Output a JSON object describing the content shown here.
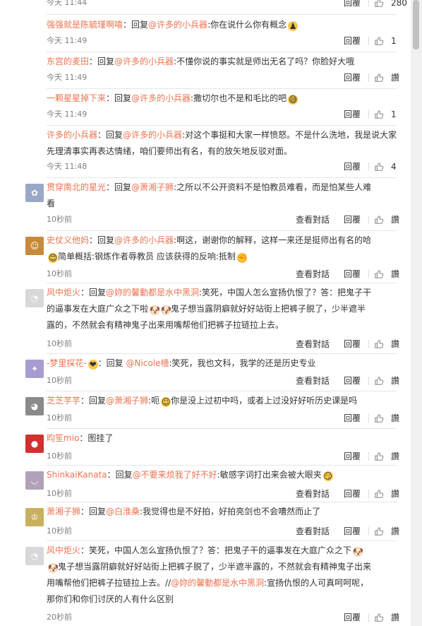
{
  "colors": {
    "link": "#eb7350",
    "text": "#333333",
    "meta": "#808080",
    "divider": "#e6e6e6"
  },
  "icons": {
    "like": "thumb-up-icon"
  },
  "actions": {
    "conversation": "查看對話",
    "reply": "回覆"
  },
  "top": {
    "time": "今天 11:44",
    "reply": "回覆",
    "likes": "280"
  },
  "comments": [
    {
      "user": "强强就是陈毓瑾啊嘻",
      "has_avatar": false,
      "segments": [
        {
          "t": "："
        },
        {
          "t": "回复"
        },
        {
          "t": "@许多的小兵器",
          "m": true
        },
        {
          "t": ":你在说什么你有概念"
        },
        {
          "e": "icon-emoji",
          "g": "♟"
        }
      ],
      "time": "今天 11:49",
      "conv": false,
      "likes": "1"
    },
    {
      "user": "东宫的麦田",
      "has_avatar": false,
      "segments": [
        {
          "t": "：回复"
        },
        {
          "t": "@许多的小兵器",
          "m": true
        },
        {
          "t": ":不懂你说的事实就是师出无名了吗？你脸好大哦"
        }
      ],
      "time": "今天 11:49",
      "conv": false,
      "likes": "讚"
    },
    {
      "user": "一颗星星掉下来",
      "has_avatar": false,
      "segments": [
        {
          "t": "：回复"
        },
        {
          "t": "@许多的小兵器",
          "m": true
        },
        {
          "t": ":撒切尔也不是和毛比的吧"
        },
        {
          "e": "sweat-face-emoji",
          "g": "😅"
        }
      ],
      "time": "今天 11:49",
      "conv": false,
      "likes": "1"
    },
    {
      "user": "许多的小兵器",
      "has_avatar": false,
      "segments": [
        {
          "t": "：回复"
        },
        {
          "t": "@许多的小兵器",
          "m": true
        },
        {
          "t": ":对这个事挺和大家一样愤怒。不是什么洗地，我是说大家"
        }
      ],
      "cont": [
        "先理清事实再表达情绪，咱们要师出有名，有的放矢地反驳对面。"
      ],
      "time": "今天 11:48",
      "conv": false,
      "likes": "4"
    },
    {
      "user": "贯穿南北的星光",
      "has_avatar": true,
      "avatar_color": "#9aa8c8",
      "avatar_glyph": "✿",
      "segments": [
        {
          "t": "：回复"
        },
        {
          "t": "@萧湘子狮",
          "m": true
        },
        {
          "t": ":之所以不公开资料不是怕教员难看，而是怕某些人难"
        }
      ],
      "cont": [
        "看"
      ],
      "time": "10秒前",
      "conv": true,
      "likes": "讚"
    },
    {
      "user": "史仗义他妈",
      "has_avatar": true,
      "avatar_color": "#c88a3a",
      "avatar_glyph": "☺",
      "segments": [
        {
          "t": "：回复"
        },
        {
          "t": "@许多的小兵器",
          "m": true
        },
        {
          "t": ":啊这，谢谢你的解释，这样一来还是挺师出有名的哈"
        }
      ],
      "cont_segments": [
        {
          "e": "smile-emoji",
          "g": "😊"
        },
        {
          "t": "简单概括:钢炼作者辱教员 应该获得的反响:抵制"
        },
        {
          "e": "fist-emoji",
          "g": "✊"
        }
      ],
      "time": "10秒前",
      "conv": true,
      "likes": "讚"
    },
    {
      "user": "风中炬火",
      "has_avatar": true,
      "avatar_color": "#d8d8d8",
      "avatar_glyph": "◔",
      "segments": [
        {
          "t": "：回复"
        },
        {
          "t": "@妳的馨動都是水中黑洞",
          "m": true
        },
        {
          "t": ":笑死，中国人怎么宣扬仇恨了？答：把鬼子干"
        }
      ],
      "cont_segments": [
        {
          "t": "的逼事发在大庭广众之下啦"
        },
        {
          "e": "dog-emoji",
          "g": "🐶"
        },
        {
          "e": "dog-emoji",
          "g": "🐶"
        },
        {
          "t": "鬼子想当露阴癖就好好站街上把裤子脱了，少半遮半"
        }
      ],
      "cont": [
        "露的，不然就会有精神鬼子出来用嘴帮他们把裤子拉链拉上去。"
      ],
      "time": "10秒前",
      "conv": true,
      "likes": "讚"
    },
    {
      "user": "-梦里探花-",
      "has_avatar": true,
      "avatar_color": "#a89bd0",
      "avatar_glyph": "✦",
      "segments": [
        {
          "e": "crown-emoji",
          "g": "❤"
        },
        {
          "t": "：回复 "
        },
        {
          "t": "@Nicole檣",
          "m": true
        },
        {
          "t": ":笑死，我也文科，我学的还是历史专业"
        }
      ],
      "time": "10秒前",
      "conv": true,
      "likes": "讚"
    },
    {
      "user": "芝芝芋芋",
      "has_avatar": true,
      "avatar_color": "#8a8a8a",
      "avatar_glyph": "◕",
      "segments": [
        {
          "t": "：回复"
        },
        {
          "t": "@萧湘子狮",
          "m": true
        },
        {
          "t": ":呃"
        },
        {
          "e": "laugh-emoji",
          "g": "☺"
        },
        {
          "t": "你是没上过初中吗，或者上过没好好听历史课是吗"
        }
      ],
      "time": "10秒前",
      "conv": false,
      "likes": "讚"
    },
    {
      "user": "昀笙mio",
      "has_avatar": true,
      "avatar_color": "#d03030",
      "avatar_glyph": "●",
      "segments": [
        {
          "t": "：图挂了"
        }
      ],
      "time": "10秒前",
      "conv": false,
      "likes": "讚"
    },
    {
      "user": "ShinkaiKanata",
      "has_avatar": true,
      "avatar_color": "#b0a0b8",
      "avatar_glyph": "◡",
      "segments": [
        {
          "t": "：回复"
        },
        {
          "t": "@不要来烦我了好不好",
          "m": true
        },
        {
          "t": ":敏感字词打出来会被大眼夹"
        },
        {
          "e": "smirk-emoji",
          "g": "😏"
        }
      ],
      "time": "10秒前",
      "conv": true,
      "likes": "讚"
    },
    {
      "user": "萧湘子狮",
      "has_avatar": true,
      "avatar_color": "#c8b060",
      "avatar_glyph": "♔",
      "segments": [
        {
          "t": "：回复"
        },
        {
          "t": "@白淮桑",
          "m": true
        },
        {
          "t": ":我觉得也是不好拍，好拍亮剑也不会嘈然而止了"
        }
      ],
      "time": "10秒前",
      "conv": true,
      "likes": "讚"
    },
    {
      "user": "风中炬火",
      "has_avatar": true,
      "avatar_color": "#d8d8d8",
      "avatar_glyph": "◔",
      "segments": [
        {
          "t": "：笑死，中国人怎么宣扬仇恨了？答：把鬼子干的逼事发在大庭广众之下"
        },
        {
          "e": "dog-emoji",
          "g": "🐶"
        }
      ],
      "cont_segments": [
        {
          "e": "dog-emoji",
          "g": "🐶"
        },
        {
          "t": "鬼子想当露阴癖就好好站街上把裤子脱了，少半遮半露的，不然就会有精神鬼子出来"
        }
      ],
      "cont_segments2": [
        {
          "t": "用嘴帮他们把裤子拉链拉上去。//"
        },
        {
          "t": "@妳的馨動都是水中黑洞",
          "m": true
        },
        {
          "t": ":宣扬仇恨的人可真呵呵呢，"
        }
      ],
      "cont": [
        "那你们和你们讨厌的人有什么区别"
      ],
      "time": "20秒前",
      "conv": false,
      "likes": "讚"
    }
  ]
}
